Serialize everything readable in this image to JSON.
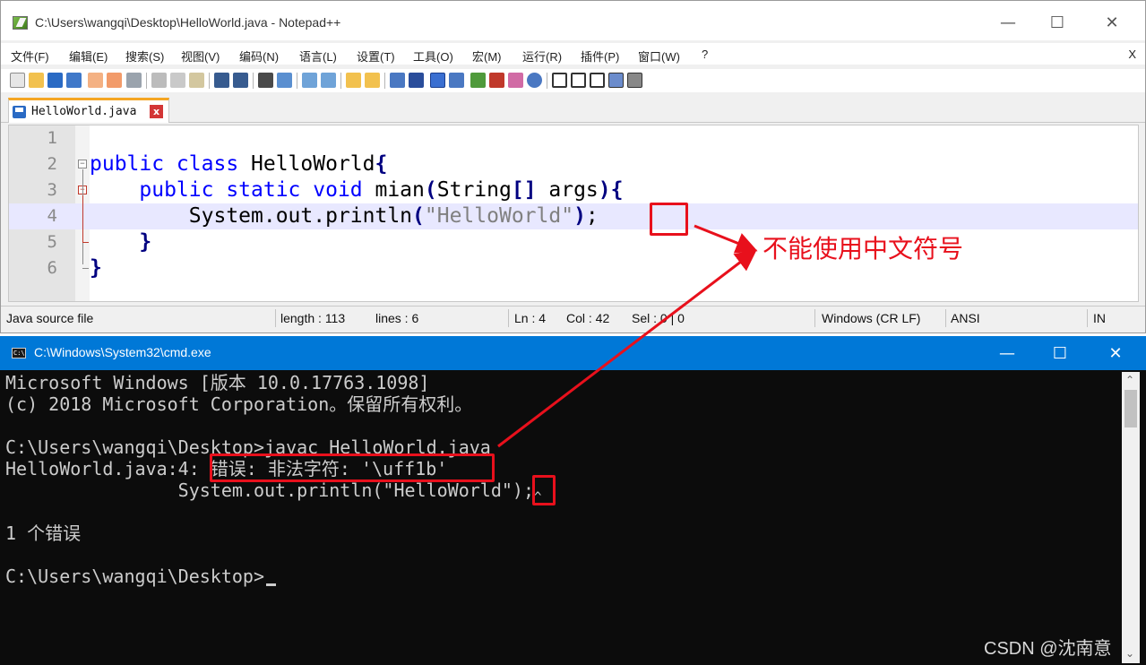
{
  "notepad": {
    "title": "C:\\Users\\wangqi\\Desktop\\HelloWorld.java - Notepad++",
    "window_controls": {
      "minimize": "—",
      "maximize": "☐",
      "close": "✕"
    },
    "menu": [
      "文件(F)",
      "编辑(E)",
      "搜索(S)",
      "视图(V)",
      "编码(N)",
      "语言(L)",
      "设置(T)",
      "工具(O)",
      "宏(M)",
      "运行(R)",
      "插件(P)",
      "窗口(W)",
      "?"
    ],
    "menu_close": "X",
    "toolbar_icons": [
      "new-file-icon",
      "open-file-icon",
      "save-icon",
      "save-all-icon",
      "close-icon",
      "close-all-icon",
      "print-icon",
      "cut-icon",
      "copy-icon",
      "paste-icon",
      "undo-icon",
      "redo-icon",
      "find-icon",
      "replace-icon",
      "zoom-in-icon",
      "zoom-out-icon",
      "sync-v-icon",
      "sync-h-icon",
      "word-wrap-icon",
      "show-all-chars-icon",
      "indent-guide-icon",
      "udl-icon",
      "doc-map-icon",
      "function-list-icon",
      "folder-workspace-icon",
      "monitor-icon",
      "record-macro-icon",
      "stop-macro-icon",
      "play-macro-icon",
      "run-macro-multiple-icon",
      "save-macro-icon"
    ],
    "tab": {
      "label": "HelloWorld.java",
      "close_glyph": "x"
    },
    "editor": {
      "line_numbers": [
        "1",
        "2",
        "3",
        "4",
        "5",
        "6"
      ],
      "line2": {
        "kw": "public class",
        "name": " HelloWorld",
        "brace": "{"
      },
      "line3": {
        "indent": "    ",
        "kw": "public static void",
        "name": " mian",
        "lparen": "(",
        "type": "String",
        "brackets": "[]",
        "arg": " args",
        "rparen": ")",
        "brace": "{"
      },
      "line4": {
        "indent": "        ",
        "call": "System.out.println",
        "lparen": "(",
        "string": "\"HelloWorld\"",
        "rparen": ")",
        "semicolon": ";"
      },
      "line5": {
        "indent": "    ",
        "brace": "}"
      },
      "line6": {
        "brace": "}"
      }
    },
    "status": {
      "file_type": "Java source file",
      "length": "length : 113",
      "lines": "lines : 6",
      "ln": "Ln : 4",
      "col": "Col : 42",
      "sel": "Sel : 0 | 0",
      "eol": "Windows (CR LF)",
      "encoding": "ANSI",
      "mode": "IN"
    }
  },
  "cmd": {
    "title": "C:\\Windows\\System32\\cmd.exe",
    "icon_text": "C:\\",
    "window_controls": {
      "minimize": "—",
      "maximize": "☐",
      "close": "✕"
    },
    "lines": {
      "l1": "Microsoft Windows [版本 10.0.17763.1098]",
      "l2": "(c) 2018 Microsoft Corporation。保留所有权利。",
      "l3": "C:\\Users\\wangqi\\Desktop>javac HelloWorld.java",
      "l4_prefix": "HelloWorld.java:4: ",
      "l4_error": "错误: 非法字符: '\\uff1b'",
      "l5": "                System.out.println(\"HelloWorld\");",
      "l5_caret": "^",
      "l6": "1 个错误",
      "l7": "C:\\Users\\wangqi\\Desktop>"
    }
  },
  "annotation": {
    "text": "不能使用中文符号",
    "color": "#e8101c"
  },
  "watermark": "CSDN @沈南意",
  "colors": {
    "keyword": "#0000ff",
    "operator": "#000080",
    "string": "#808080",
    "cmd_bg": "#0c0c0c",
    "cmd_title": "#0078d7",
    "current_line": "#e8e8ff",
    "tab_accent": "#f5a623"
  }
}
